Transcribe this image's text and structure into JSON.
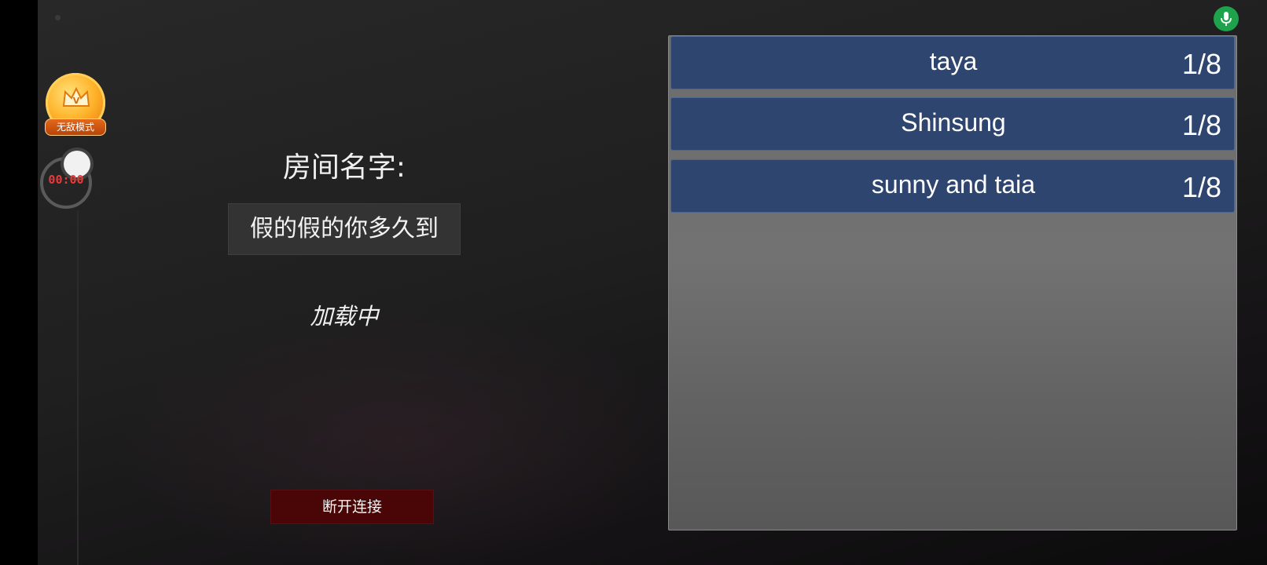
{
  "overlay": {
    "vip_badge_label": "无敌模式",
    "record_timer": "00:00",
    "mic_icon": "microphone-icon"
  },
  "lobby": {
    "room_name_label": "房间名字:",
    "room_name_value": "假的假的你多久到",
    "status_text": "加载中",
    "disconnect_label": "断开连接"
  },
  "room_list": [
    {
      "name": "taya",
      "players": "1/8"
    },
    {
      "name": "Shinsung",
      "players": "1/8"
    },
    {
      "name": "sunny and taia",
      "players": "1/8"
    }
  ],
  "colors": {
    "room_row_bg": "#2e466f",
    "disconnect_bg": "#4a0506",
    "mic_green": "#1ea34c",
    "timer_red": "#e63b3b"
  }
}
